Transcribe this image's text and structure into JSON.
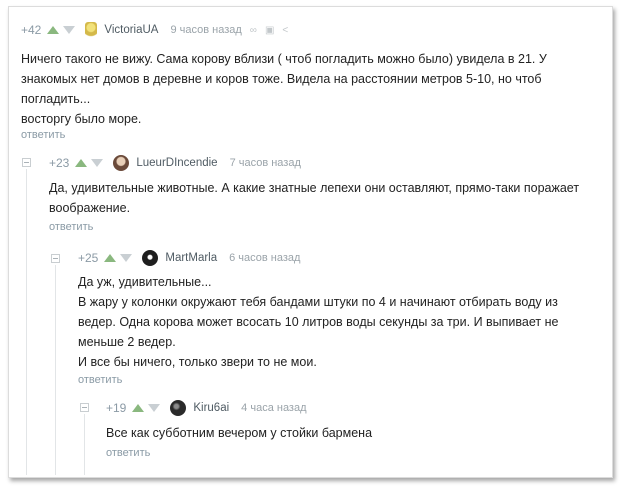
{
  "comments": [
    {
      "rating": "+42",
      "author": "VictoriaUA",
      "time": "9 часов назад",
      "lines": [
        "Ничего такого не вижу. Сама корову вблизи ( чтоб погладить можно было) увидела в 21. У",
        "знакомых нет домов в деревне и коров тоже. Видела на расстоянии метров 5-10, но чтоб",
        "погладить...",
        "восторгу было море."
      ],
      "reply": "ответить"
    },
    {
      "rating": "+23",
      "author": "LueurDIncendie",
      "time": "7 часов назад",
      "lines": [
        "Да, удивительные животные. А какие знатные лепехи они оставляют, прямо-таки поражает",
        "воображение."
      ],
      "reply": "ответить"
    },
    {
      "rating": "+25",
      "author": "MartMarla",
      "time": "6 часов назад",
      "lines": [
        "Да уж, удивительные...",
        "В жару у колонки окружают тебя бандами штуки по 4 и начинают отбирать воду из",
        "ведер. Одна корова может всосать 10 литров воды секунды за три. И выпивает не",
        "меньше 2 ведер.",
        "И все бы ничего, только звери то не мои."
      ],
      "reply": "ответить"
    },
    {
      "rating": "+19",
      "author": "Kiru6ai",
      "time": "4 часа назад",
      "lines": [
        "Все как субботним вечером у стойки бармена"
      ],
      "reply": "ответить"
    }
  ],
  "colors": {
    "vote_up": "#8ab87f",
    "vote_down": "#c9cfd3",
    "reply": "#8a9aa5"
  }
}
